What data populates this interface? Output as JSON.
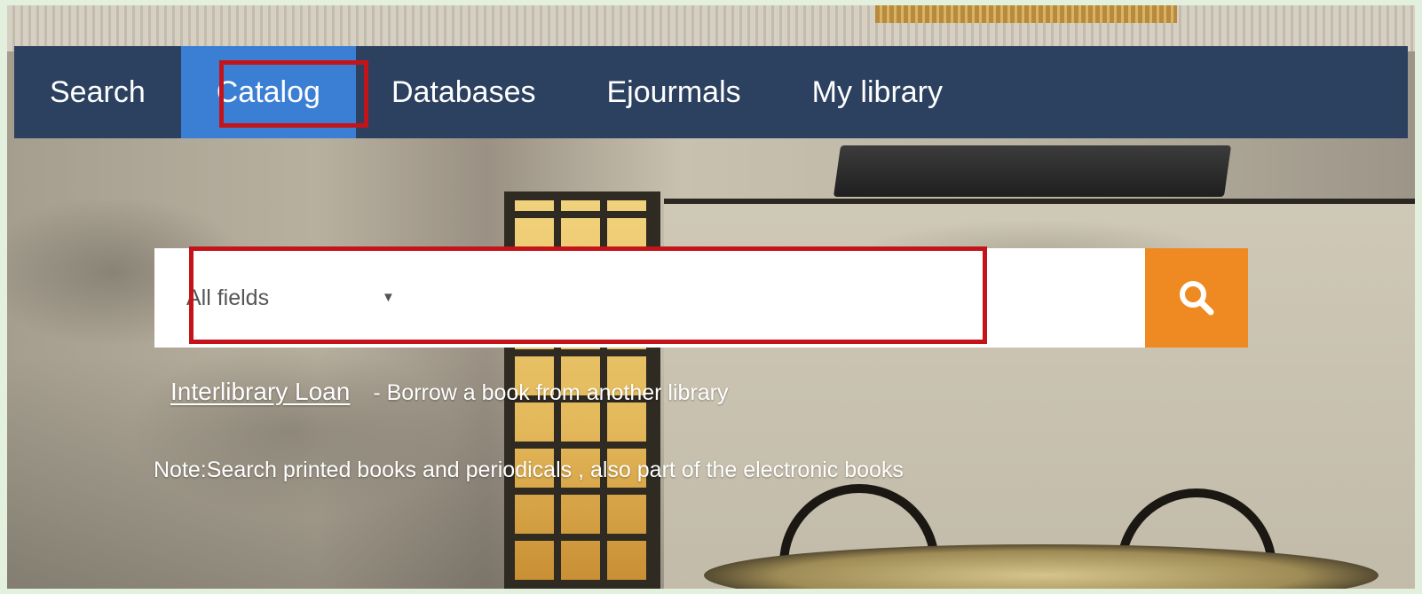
{
  "nav": {
    "items": [
      {
        "label": "Search",
        "active": false
      },
      {
        "label": "Catalog",
        "active": true
      },
      {
        "label": "Databases",
        "active": false
      },
      {
        "label": "Ejourmals",
        "active": false
      },
      {
        "label": "My library",
        "active": false
      }
    ]
  },
  "search": {
    "field_select": "All fields",
    "caret_glyph": "▼",
    "input_value": "",
    "button_icon": "search-icon"
  },
  "links": {
    "interlibrary_loan": "Interlibrary Loan",
    "interlibrary_desc": "- Borrow a book from another library"
  },
  "note": "Note:Search printed books and periodicals , also part of the electronic books",
  "colors": {
    "nav_bg": "#2c4160",
    "nav_active": "#3b7fd4",
    "search_button": "#ee8a21",
    "highlight": "#c4141a"
  }
}
